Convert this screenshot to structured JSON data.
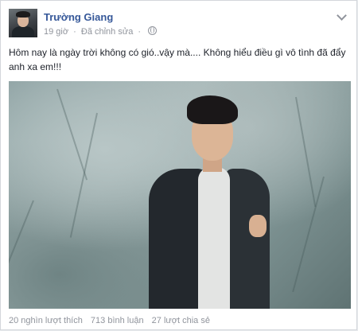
{
  "post": {
    "author": "Trường Giang",
    "time": "19 giờ",
    "separator": "·",
    "edited": "Đã chỉnh sửa",
    "separator2": "·",
    "text": "Hôm nay là ngày trời không có gió..vậy mà.... Không hiểu điều gì vô tình đã đẩy anh xa em!!!",
    "icons": {
      "privacy": "globe-icon",
      "options": "chevron-down-icon"
    }
  },
  "stats": {
    "likes": "20 nghìn lượt thích",
    "comments": "713 bình luận",
    "shares": "27 lượt chia sẻ"
  },
  "colors": {
    "author": "#365899",
    "meta": "#90949c",
    "text": "#1d2129"
  }
}
